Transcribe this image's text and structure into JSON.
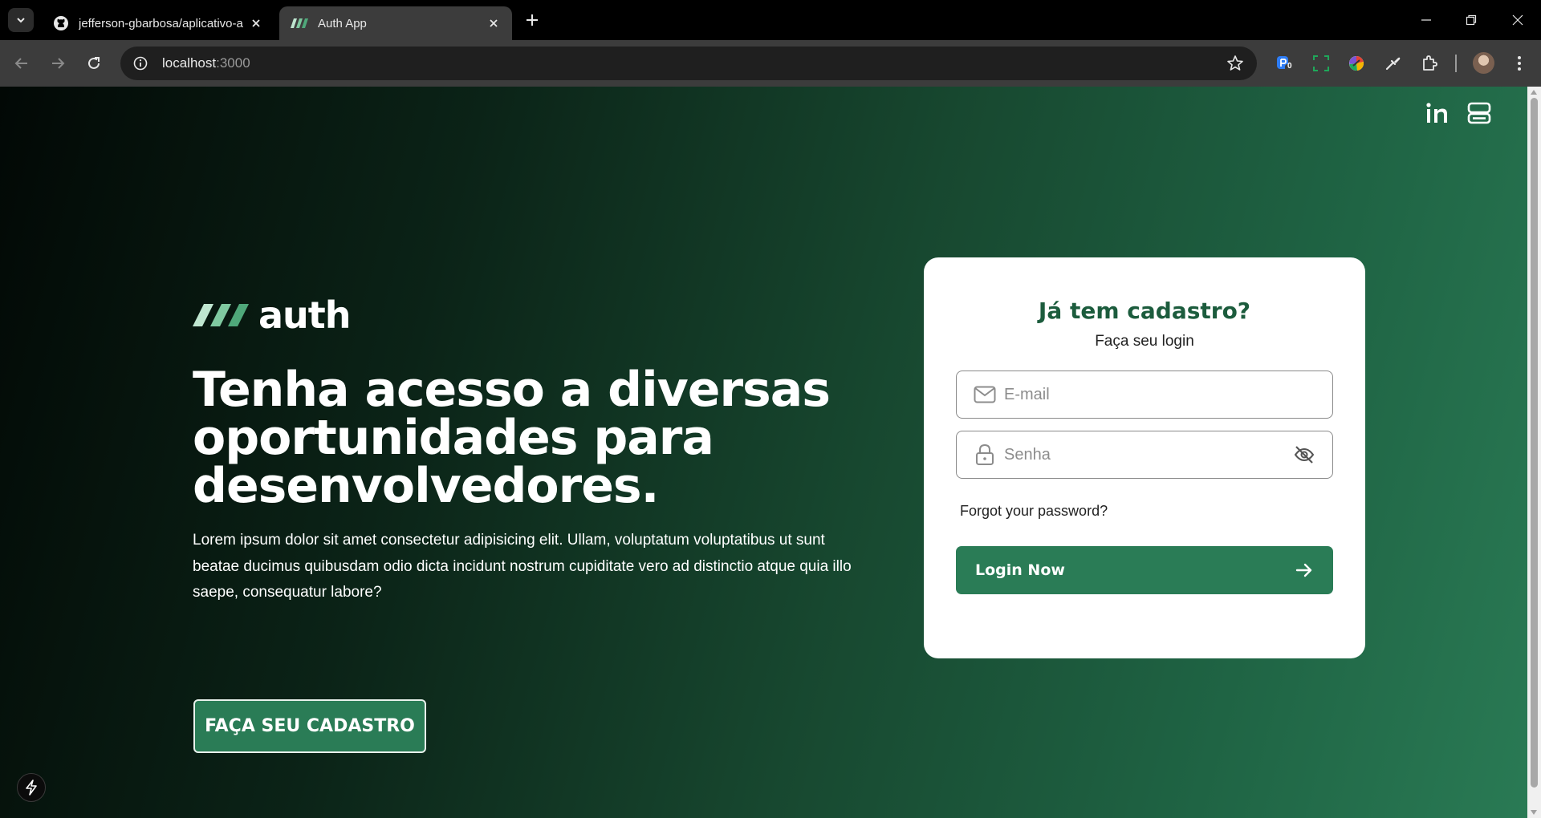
{
  "browser": {
    "tabs": [
      {
        "title": "jefferson-gbarbosa/aplicativo-a",
        "icon": "github-icon",
        "active": false
      },
      {
        "title": "Auth App",
        "icon": "auth-logo-icon",
        "active": true
      }
    ],
    "url_host": "localhost",
    "url_port": ":3000",
    "extension_badge": "0"
  },
  "page": {
    "logo_text": "auth",
    "headline": "Tenha acesso a diversas oportunidades para desenvolvedores.",
    "lead": "Lorem ipsum dolor sit amet consectetur adipisicing elit. Ullam, voluptatum voluptatibus ut sunt beatae ducimus quibusdam odio dicta incidunt nostrum cupiditate vero ad distinctio atque quia illo saepe, consequatur labore?",
    "signup_label": "FAÇA SEU CADASTRO",
    "top_icons": [
      "linkedin-icon",
      "server-icon"
    ]
  },
  "login": {
    "title": "Já tem cadastro?",
    "subtitle": "Faça seu login",
    "email_placeholder": "E-mail",
    "password_placeholder": "Senha",
    "forgot_label": "Forgot your password?",
    "submit_label": "Login Now"
  },
  "colors": {
    "brand_green": "#2a7c56",
    "title_green": "#1c5c3d",
    "logo_stripe_light": "#bfe6d0",
    "logo_stripe_mid": "#7fc9a0",
    "logo_stripe_dark": "#4fa87a"
  }
}
